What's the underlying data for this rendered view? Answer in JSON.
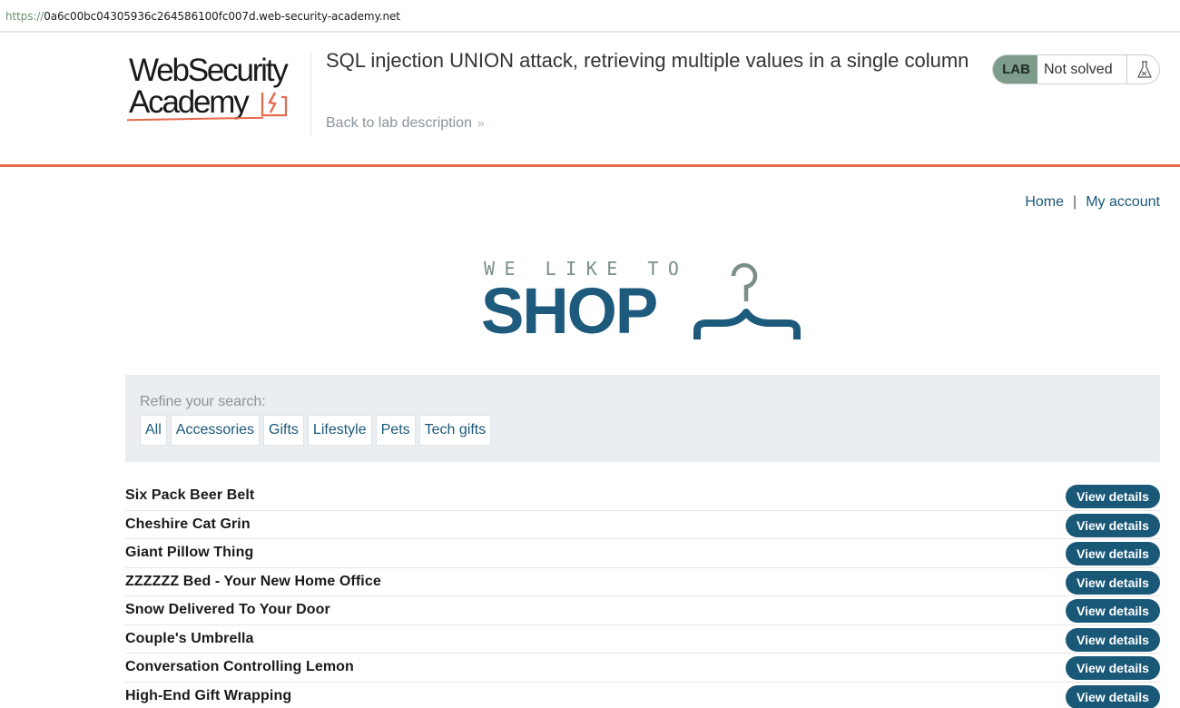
{
  "browser": {
    "url_scheme": "https://",
    "url_rest": "0a6c00bc04305936c264586100fc007d.web-security-academy.net"
  },
  "academy_header": {
    "logo_line1": "WebSecurity",
    "logo_line2": "Academy",
    "lab_title": "SQL injection UNION attack, retrieving multiple values in a single column",
    "back_link": "Back to lab description",
    "back_chevron": "»",
    "lab_badge": "LAB",
    "status": "Not solved",
    "status_icon": "flask-icon",
    "accent_color": "#e56a4c"
  },
  "shop_nav": {
    "home": "Home",
    "separator": "|",
    "my_account": "My account"
  },
  "shop_logo": {
    "tagline": "WE LIKE TO",
    "word": "SHOP",
    "icon": "hanger-icon"
  },
  "filters": {
    "label": "Refine your search:",
    "items": [
      "All",
      "Accessories",
      "Gifts",
      "Lifestyle",
      "Pets",
      "Tech gifts"
    ]
  },
  "products": {
    "button_label": "View details",
    "items": [
      "Six Pack Beer Belt",
      "Cheshire Cat Grin",
      "Giant Pillow Thing",
      "ZZZZZZ Bed - Your New Home Office",
      "Snow Delivered To Your Door",
      "Couple's Umbrella",
      "Conversation Controlling Lemon",
      "High-End Gift Wrapping"
    ]
  },
  "colors": {
    "brand_blue": "#1a5878",
    "lab_green": "#7d9c8b",
    "filter_bg": "#eaeef1"
  }
}
